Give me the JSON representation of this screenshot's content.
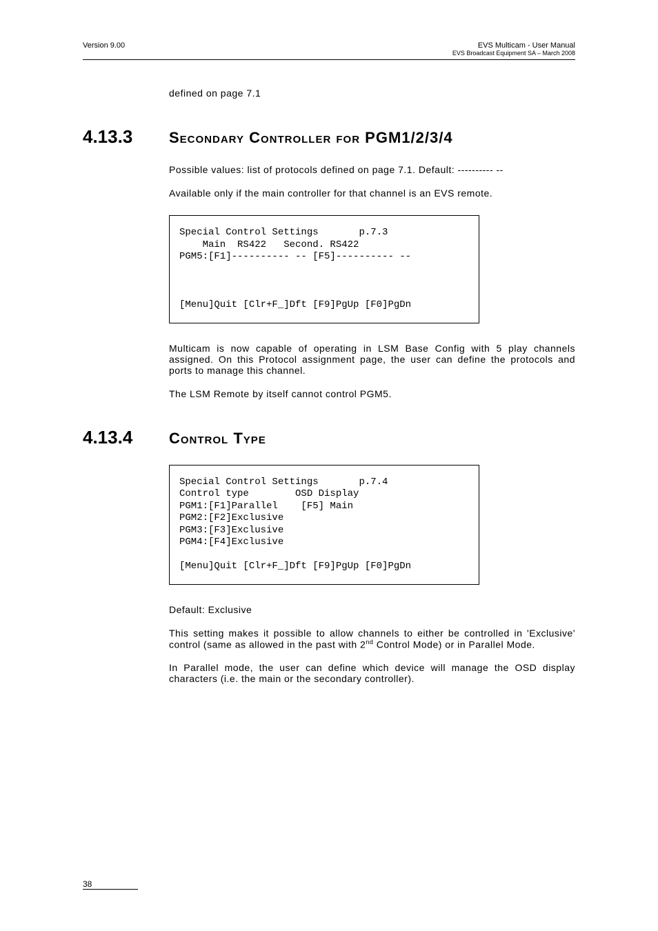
{
  "header": {
    "left": "Version 9.00",
    "rightTop": "EVS Multicam - User Manual",
    "rightSub": "EVS Broadcast Equipment SA – March 2008"
  },
  "intro_para": "defined on page 7.1",
  "section_4_13_3": {
    "num": "4.13.3",
    "title": "Secondary Controller for PGM1/2/3/4",
    "p1": "Possible values: list of protocols defined on page 7.1. Default: ---------- --",
    "p2": "Available only if the main controller for that channel is an EVS remote.",
    "code": "Special Control Settings       p.7.3\n    Main  RS422   Second. RS422\nPGM5:[F1]---------- -- [F5]---------- --\n\n\n\n[Menu]Quit [Clr+F_]Dft [F9]PgUp [F0]PgDn",
    "p3": "Multicam is now capable of operating in LSM Base Config with 5 play channels assigned. On this Protocol assignment page, the user can define the protocols and ports to manage this channel.",
    "p4": "The LSM Remote by itself cannot control PGM5."
  },
  "section_4_13_4": {
    "num": "4.13.4",
    "title": "Control Type",
    "code": "Special Control Settings       p.7.4\nControl type        OSD Display\nPGM1:[F1]Parallel    [F5] Main\nPGM2:[F2]Exclusive\nPGM3:[F3]Exclusive\nPGM4:[F4]Exclusive\n\n[Menu]Quit [Clr+F_]Dft [F9]PgUp [F0]PgDn",
    "p1": "Default: Exclusive",
    "p2_a": "This setting makes it possible to allow channels to either be controlled in 'Exclusive' control (same as allowed in the past with 2",
    "p2_sup": "nd",
    "p2_b": " Control Mode) or in Parallel Mode.",
    "p3": "In Parallel mode, the user can define which device will manage the OSD display characters (i.e. the main or the secondary controller)."
  },
  "footer": {
    "pagenum": "38"
  }
}
